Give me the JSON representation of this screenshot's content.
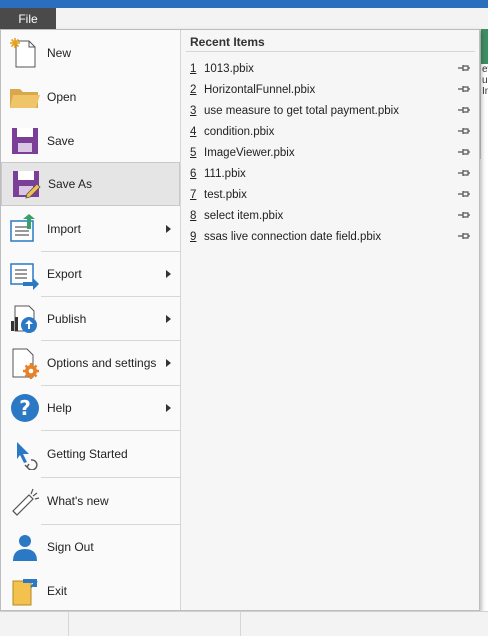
{
  "ribbon": {
    "file_tab": "File"
  },
  "background": {
    "fragment_lines": [
      "ev",
      "u",
      "In"
    ]
  },
  "menu": {
    "items": [
      {
        "label": "New",
        "icon": "new-document-icon",
        "arrow": false
      },
      {
        "label": "Open",
        "icon": "folder-icon",
        "arrow": false
      },
      {
        "label": "Save",
        "icon": "save-icon",
        "arrow": false
      },
      {
        "label": "Save As",
        "icon": "save-as-icon",
        "arrow": false
      },
      {
        "label": "Import",
        "icon": "import-icon",
        "arrow": true
      },
      {
        "label": "Export",
        "icon": "export-icon",
        "arrow": true
      },
      {
        "label": "Publish",
        "icon": "publish-icon",
        "arrow": true
      },
      {
        "label": "Options and settings",
        "icon": "options-icon",
        "arrow": true
      },
      {
        "label": "Help",
        "icon": "help-icon",
        "arrow": true
      },
      {
        "label": "Getting Started",
        "icon": "getting-started-icon",
        "arrow": false
      },
      {
        "label": "What's new",
        "icon": "megaphone-icon",
        "arrow": false
      },
      {
        "label": "Sign Out",
        "icon": "user-icon",
        "arrow": false
      },
      {
        "label": "Exit",
        "icon": "exit-icon",
        "arrow": false
      }
    ],
    "hovered": "Save As"
  },
  "recent": {
    "title": "Recent Items",
    "items": [
      {
        "num": "1",
        "name": "1013.pbix"
      },
      {
        "num": "2",
        "name": "HorizontalFunnel.pbix"
      },
      {
        "num": "3",
        "name": "use measure to get total payment.pbix"
      },
      {
        "num": "4",
        "name": "condition.pbix"
      },
      {
        "num": "5",
        "name": "ImageViewer.pbix"
      },
      {
        "num": "6",
        "name": "111.pbix"
      },
      {
        "num": "7",
        "name": "test.pbix"
      },
      {
        "num": "8",
        "name": "select item.pbix"
      },
      {
        "num": "9",
        "name": "ssas live connection date field.pbix"
      }
    ]
  },
  "colors": {
    "title_bar": "#2a6fbd",
    "file_tab": "#4a4a4a",
    "hover": "#e5e5e5",
    "accent_orange": "#e8822a",
    "icon_purple": "#7b3f98",
    "icon_blue": "#2b78c5"
  }
}
